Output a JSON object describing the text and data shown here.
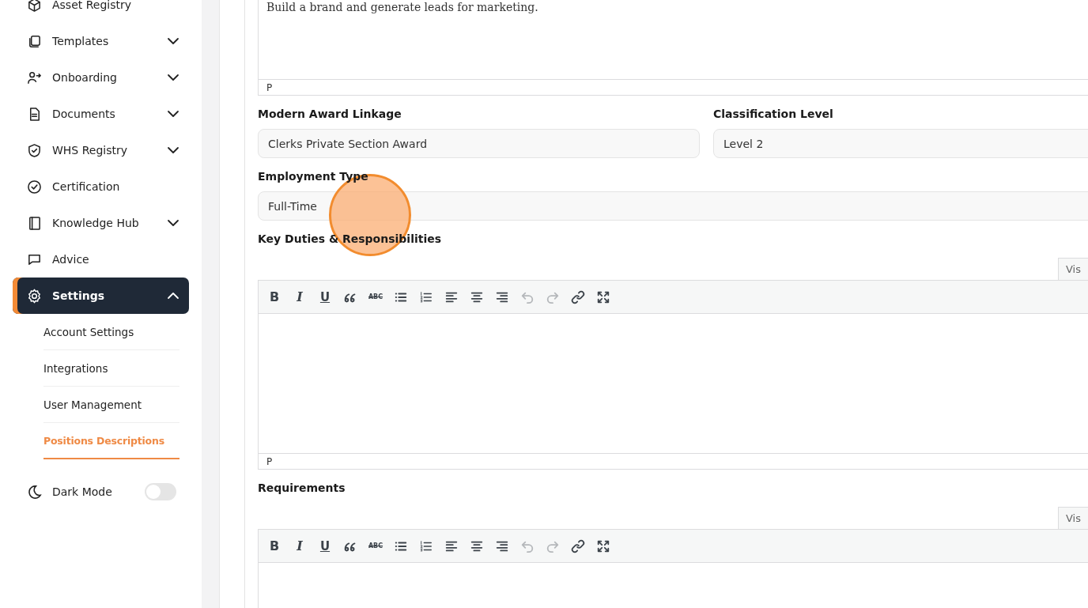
{
  "sidebar": {
    "items": [
      {
        "label": "Asset Registry",
        "kind": "link",
        "selected": false
      },
      {
        "label": "Templates",
        "kind": "menu",
        "expanded": false,
        "selected": false
      },
      {
        "label": "Onboarding",
        "kind": "menu",
        "expanded": false,
        "selected": false
      },
      {
        "label": "Documents",
        "kind": "menu",
        "expanded": false,
        "selected": false
      },
      {
        "label": "WHS Registry",
        "kind": "menu",
        "expanded": false,
        "selected": false
      },
      {
        "label": "Certification",
        "kind": "link",
        "selected": false
      },
      {
        "label": "Knowledge Hub",
        "kind": "menu",
        "expanded": false,
        "selected": false
      },
      {
        "label": "Advice",
        "kind": "link",
        "selected": false
      },
      {
        "label": "Settings",
        "kind": "menu",
        "expanded": true,
        "selected": true,
        "children": [
          {
            "label": "Account Settings",
            "selected": false
          },
          {
            "label": "Integrations",
            "selected": false
          },
          {
            "label": "User Management",
            "selected": false
          },
          {
            "label": "Positions Descriptions",
            "selected": true
          }
        ]
      }
    ],
    "dark_mode": {
      "label": "Dark Mode",
      "on": false
    }
  },
  "form": {
    "top_editor": {
      "text": "Build a brand and generate leads for marketing.",
      "status": "P"
    },
    "fields_row": [
      {
        "label": "Modern Award Linkage",
        "value": "Clerks Private Section Award"
      },
      {
        "label": "Classification Level",
        "value": "Level 2"
      }
    ],
    "employment_type": {
      "label": "Employment Type",
      "value": "Full-Time"
    },
    "editors": [
      {
        "label": "Key Duties & Responsibilities",
        "tab": "Vis",
        "status": "P",
        "toolbar": [
          {
            "kind": "bold",
            "label": "B",
            "disabled": false
          },
          {
            "kind": "italic",
            "label": "I",
            "disabled": false
          },
          {
            "kind": "underline",
            "label": "U",
            "disabled": false
          },
          {
            "kind": "quote",
            "disabled": false
          },
          {
            "kind": "strike",
            "label": "ABC",
            "disabled": false
          },
          {
            "kind": "bullets",
            "disabled": false
          },
          {
            "kind": "numbers",
            "disabled": false
          },
          {
            "kind": "align-left",
            "disabled": false
          },
          {
            "kind": "align-center",
            "disabled": false
          },
          {
            "kind": "align-right",
            "disabled": false
          },
          {
            "kind": "undo",
            "disabled": true
          },
          {
            "kind": "redo",
            "disabled": true
          },
          {
            "kind": "link",
            "disabled": false
          },
          {
            "kind": "fullscreen",
            "disabled": false
          }
        ]
      },
      {
        "label": "Requirements",
        "tab": "Vis",
        "toolbar": [
          {
            "kind": "bold",
            "label": "B",
            "disabled": false
          },
          {
            "kind": "italic",
            "label": "I",
            "disabled": false
          },
          {
            "kind": "underline",
            "label": "U",
            "disabled": false
          },
          {
            "kind": "quote",
            "disabled": false
          },
          {
            "kind": "strike",
            "label": "ABC",
            "disabled": false
          },
          {
            "kind": "bullets",
            "disabled": false
          },
          {
            "kind": "numbers",
            "disabled": false
          },
          {
            "kind": "align-left",
            "disabled": false
          },
          {
            "kind": "align-center",
            "disabled": false
          },
          {
            "kind": "align-right",
            "disabled": false
          },
          {
            "kind": "undo",
            "disabled": true
          },
          {
            "kind": "redo",
            "disabled": true
          },
          {
            "kind": "link",
            "disabled": false
          },
          {
            "kind": "fullscreen",
            "disabled": false
          }
        ]
      }
    ]
  }
}
